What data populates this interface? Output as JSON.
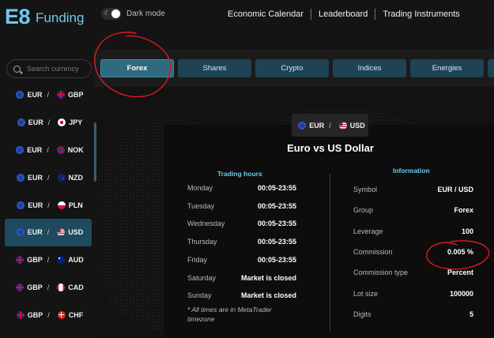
{
  "header": {
    "logo_mark": "E8",
    "logo_text": "Funding",
    "dark_mode_label": "Dark mode",
    "nav": [
      "Economic Calendar",
      "Leaderboard",
      "Trading Instruments"
    ]
  },
  "search": {
    "placeholder": "Search currency"
  },
  "pairs": [
    {
      "base": "EUR",
      "quote": "GBP",
      "base_flag": "eu-flag-icon",
      "quote_flag": "uk-flag-icon"
    },
    {
      "base": "EUR",
      "quote": "JPY",
      "base_flag": "eu-flag-icon",
      "quote_flag": "japan-flag-icon"
    },
    {
      "base": "EUR",
      "quote": "NOK",
      "base_flag": "eu-flag-icon",
      "quote_flag": "norway-flag-icon"
    },
    {
      "base": "EUR",
      "quote": "NZD",
      "base_flag": "eu-flag-icon",
      "quote_flag": "nz-flag-icon"
    },
    {
      "base": "EUR",
      "quote": "PLN",
      "base_flag": "eu-flag-icon",
      "quote_flag": "poland-flag-icon"
    },
    {
      "base": "EUR",
      "quote": "USD",
      "base_flag": "eu-flag-icon",
      "quote_flag": "us-flag-icon",
      "active": true
    },
    {
      "base": "GBP",
      "quote": "AUD",
      "base_flag": "uk-flag-icon",
      "quote_flag": "australia-flag-icon"
    },
    {
      "base": "GBP",
      "quote": "CAD",
      "base_flag": "uk-flag-icon",
      "quote_flag": "canada-flag-icon"
    },
    {
      "base": "GBP",
      "quote": "CHF",
      "base_flag": "uk-flag-icon",
      "quote_flag": "swiss-flag-icon"
    }
  ],
  "tabs": [
    "Forex",
    "Shares",
    "Crypto",
    "Indices",
    "Energies"
  ],
  "active_tab": "Forex",
  "detail": {
    "base": "EUR",
    "quote": "USD",
    "title": "Euro vs US Dollar",
    "trading_hours_title": "Trading hours",
    "information_title": "Information",
    "hours": [
      {
        "day": "Monday",
        "value": "00:05-23:55"
      },
      {
        "day": "Tuesday",
        "value": "00:05-23:55"
      },
      {
        "day": "Wednesday",
        "value": "00:05-23:55"
      },
      {
        "day": "Thursday",
        "value": "00:05-23:55"
      },
      {
        "day": "Friday",
        "value": "00:05-23:55"
      },
      {
        "day": "Saturday",
        "value": "Market is closed"
      },
      {
        "day": "Sunday",
        "value": "Market is closed"
      }
    ],
    "timezone_note": "* All times are in MetaTrader timezone",
    "info": [
      {
        "label": "Symbol",
        "value": "EUR / USD"
      },
      {
        "label": "Group",
        "value": "Forex"
      },
      {
        "label": "Leverage",
        "value": "100"
      },
      {
        "label": "Commission",
        "value": "0.005 %"
      },
      {
        "label": "Commission type",
        "value": "Percent"
      },
      {
        "label": "Lot size",
        "value": "100000"
      },
      {
        "label": "Digits",
        "value": "5"
      }
    ]
  },
  "colors": {
    "accent": "#6ec9ec",
    "active_tab": "#2f6a80",
    "tab": "#1e4353",
    "active_pair": "#1d4a5e",
    "annotation": "#e0191f"
  }
}
